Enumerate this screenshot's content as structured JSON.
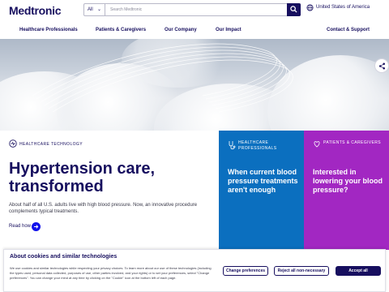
{
  "header": {
    "logo": "Medtronic",
    "search": {
      "scope": "All",
      "placeholder": "Search Medtronic"
    },
    "region": "United States of America"
  },
  "nav": {
    "items": [
      "Healthcare Professionals",
      "Patients & Caregivers",
      "Our Company",
      "Our Impact"
    ],
    "contact": "Contact & Support"
  },
  "hero": {
    "tag": "HEALTHCARE TECHNOLOGY",
    "headline": "Hypertension care, transformed",
    "text": "About half of all U.S. adults live with high blood pressure. Now, an innovative procedure complements typical treatments.",
    "cta": "Read how"
  },
  "cards": [
    {
      "tag": "HEALTHCARE PROFESSIONALS",
      "title": "When current blood pressure treatments aren't enough",
      "color": "#0b6fbf"
    },
    {
      "tag": "PATIENTS & CAREGIVERS",
      "title": "Interested in lowering your blood pressure?",
      "color": "#a227c2"
    }
  ],
  "cookie": {
    "title": "About cookies and similar technologies",
    "text": "We use cookies and similar technologies while respecting your privacy choices. To learn more about our use of these technologies (including the types used, personal data collected, purposes of use, other parties involved, and your rights) or to set your preferences, select \"Change preferences\". You can change your mind at any time by clicking on the \"Cookie\" icon at the bottom left of each page.",
    "buttons": {
      "preferences": "Change preferences",
      "reject": "Reject all non-necessary",
      "accept": "Accept all"
    }
  },
  "colors": {
    "brand": "#170f5f",
    "blue": "#0b6fbf",
    "purple": "#a227c2",
    "link": "#1010eb"
  }
}
